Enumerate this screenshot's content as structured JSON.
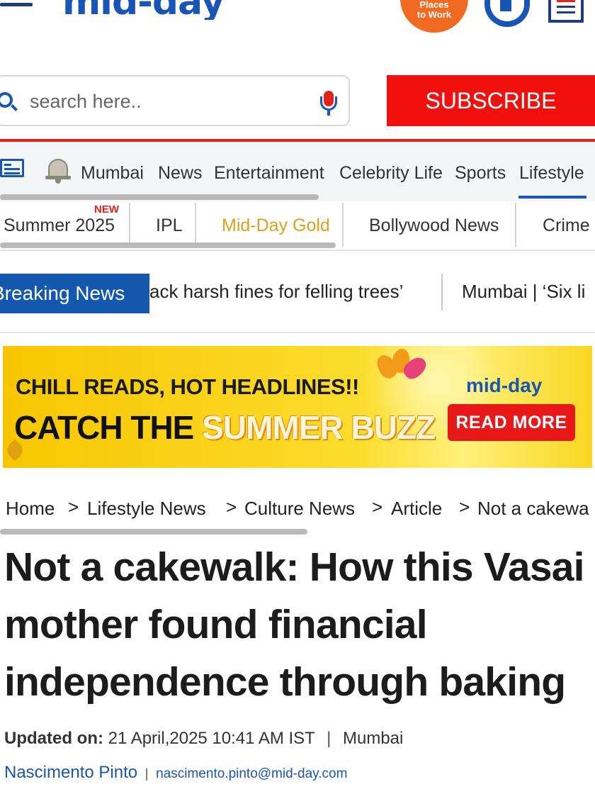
{
  "header": {
    "logo_text": "mid-day",
    "gpw_badge_line1": "Places",
    "gpw_badge_line2": "to Work"
  },
  "search": {
    "placeholder": "search here.."
  },
  "subscribe_label": "SUBSCRIBE",
  "nav": {
    "items": [
      "Mumbai",
      "News",
      "Entertainment",
      "Celebrity Life",
      "Sports",
      "Lifestyle"
    ],
    "active": "Lifestyle"
  },
  "subnav": {
    "new_badge": "NEW",
    "items": [
      "Summer 2025",
      "IPL",
      "Mid-Day Gold",
      "Bollywood News",
      "Crime"
    ]
  },
  "breaking": {
    "label": "Breaking News",
    "items": [
      "ack harsh fines for felling trees’",
      "Mumbai | ‘Six li"
    ]
  },
  "banner": {
    "line1": "CHILL READS, HOT HEADLINES!!",
    "line2_prefix": "CATCH THE ",
    "line2_highlight": "SUMMER BUZZ",
    "logo": "mid-day",
    "cta": "READ MORE"
  },
  "breadcrumb": {
    "items": [
      "Home",
      "Lifestyle News",
      "Culture News",
      "Article",
      "Not a cakewa"
    ],
    "separator": ">"
  },
  "article": {
    "headline": "Not a cakewalk: How this Vasai mother found financial independence through baking",
    "updated_label": "Updated on:",
    "updated_value": "21 April,2025 10:41 AM IST",
    "location": "Mumbai",
    "author": "Nascimento Pinto",
    "author_email": "nascimento.pinto@mid-day.com"
  },
  "colors": {
    "brand_blue": "#1855b5",
    "brand_red": "#e2231a",
    "subscribe_red": "#f0100e",
    "gold": "#d9a21c",
    "banner_yellow": "#f7c600"
  },
  "icons": [
    "hamburger-menu-icon",
    "great-place-to-work-badge",
    "app-icon",
    "epaper-icon",
    "search-icon",
    "microphone-icon",
    "bell-icon"
  ]
}
